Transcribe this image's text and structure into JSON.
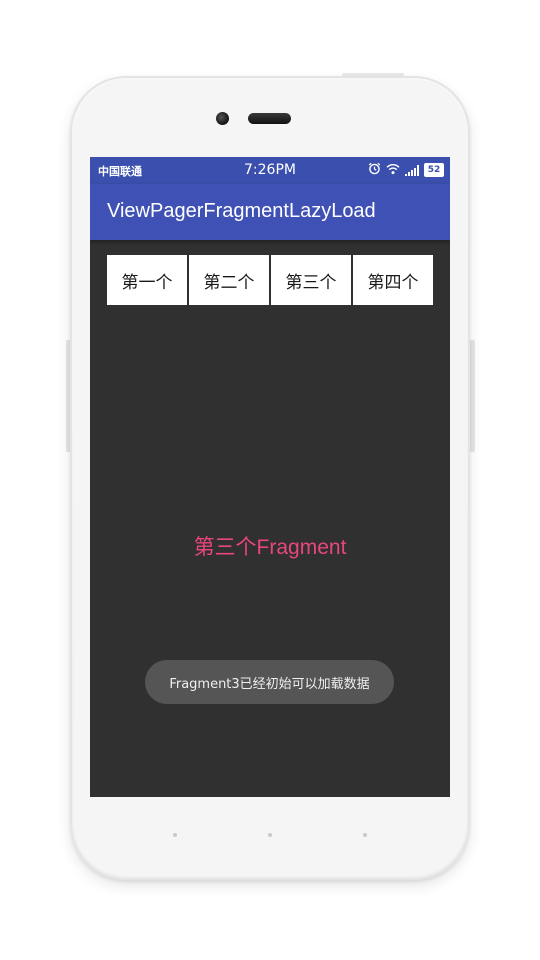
{
  "status_bar": {
    "carrier": "中国联通",
    "time": "7:26PM",
    "battery": "52",
    "icons": [
      "alarm-icon",
      "wifi-icon",
      "signal-icon",
      "battery-icon"
    ]
  },
  "app_bar": {
    "title": "ViewPagerFragmentLazyLoad",
    "color": "#3f51b5"
  },
  "tabs": [
    {
      "label": "第一个"
    },
    {
      "label": "第二个"
    },
    {
      "label": "第三个"
    },
    {
      "label": "第四个"
    }
  ],
  "content": {
    "fragment_text": "第三个Fragment",
    "text_color": "#e8467c",
    "background": "#303030"
  },
  "toast": {
    "message": "Fragment3已经初始可以加载数据"
  }
}
